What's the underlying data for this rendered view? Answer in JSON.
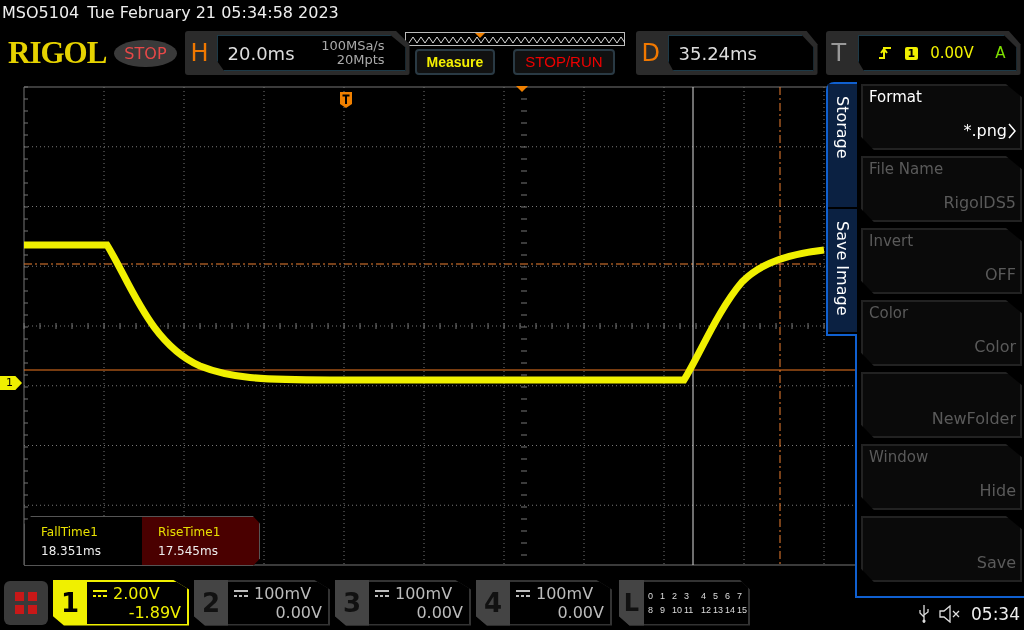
{
  "status_line": {
    "model": "MSO5104",
    "datetime": "Tue February 21 05:34:58 2023"
  },
  "header": {
    "logo": "RIGOL",
    "run_state": "STOP",
    "horizontal": {
      "label": "H",
      "timebase": "20.0ms",
      "sample_rate": "100MSa/s",
      "memory_depth": "20Mpts"
    },
    "buttons": [
      {
        "label": "Measure",
        "kind": "measure"
      },
      {
        "label": "STOP/RUN",
        "kind": "run"
      }
    ],
    "delay": {
      "label": "D",
      "value": "35.24ms"
    },
    "trigger": {
      "label": "T",
      "channel": "1",
      "level": "0.00V",
      "mode": "A"
    }
  },
  "plot": {
    "channel_marker": "1",
    "measurements": [
      {
        "label": "FallTime1",
        "value": "18.351ms",
        "selected": false
      },
      {
        "label": "RiseTime1",
        "value": "17.545ms",
        "selected": true
      }
    ]
  },
  "side_menu": {
    "tabs": [
      {
        "label": "Storage"
      },
      {
        "label": "Save Image"
      }
    ],
    "items": [
      {
        "label": "Format",
        "value": "*.png",
        "disabled": false,
        "kind": "submenu"
      },
      {
        "label": "File Name",
        "value": "RigolDS5",
        "disabled": true,
        "kind": "value"
      },
      {
        "label": "Invert",
        "value": "OFF",
        "disabled": true,
        "kind": "value"
      },
      {
        "label": "Color",
        "value": "Color",
        "disabled": true,
        "kind": "value"
      },
      {
        "value": "NewFolder",
        "disabled": true,
        "kind": "value"
      },
      {
        "label": "Window",
        "value": "Hide",
        "disabled": true,
        "kind": "value"
      },
      {
        "value": "Save",
        "disabled": true,
        "kind": "value"
      }
    ]
  },
  "channels": [
    {
      "number": "1",
      "scale": "2.00V",
      "offset": "-1.89V",
      "on": true
    },
    {
      "number": "2",
      "scale": "100mV",
      "offset": "0.00V",
      "on": false
    },
    {
      "number": "3",
      "scale": "100mV",
      "offset": "0.00V",
      "on": false
    },
    {
      "number": "4",
      "scale": "100mV",
      "offset": "0.00V",
      "on": false
    }
  ],
  "logic": {
    "label": "L",
    "rows": [
      [
        "0",
        "1",
        "2",
        "3",
        "4",
        "5",
        "6",
        "7"
      ],
      [
        "8",
        "9",
        "10",
        "11",
        "12",
        "13",
        "14",
        "15"
      ]
    ]
  },
  "clock": "05:34"
}
